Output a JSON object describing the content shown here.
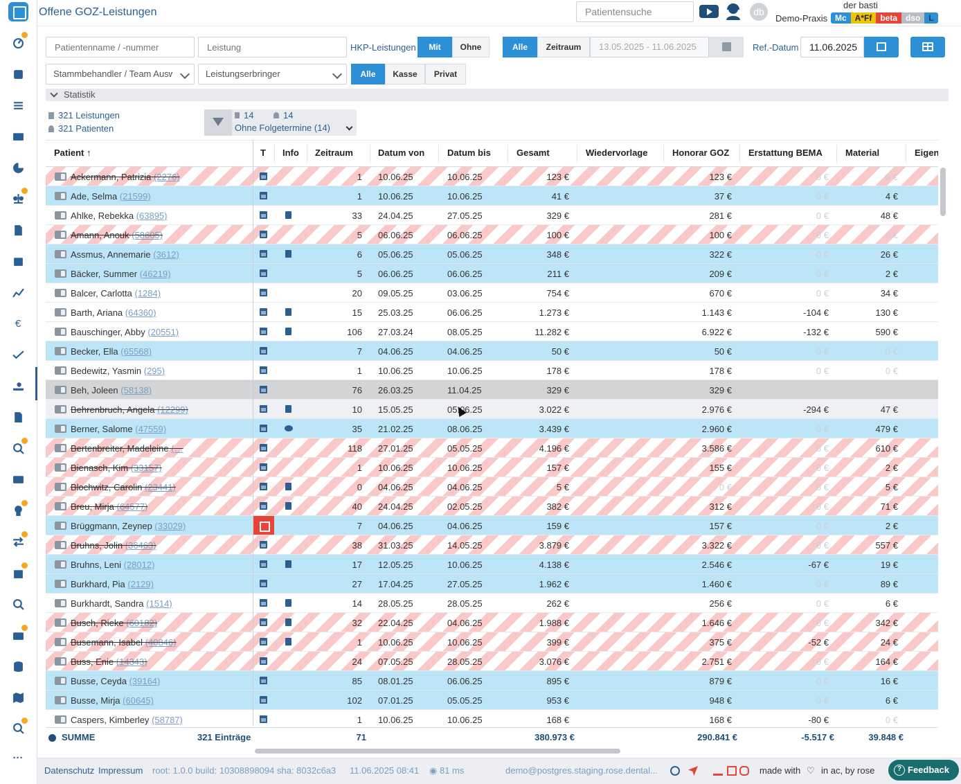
{
  "header": {
    "title": "Offene GOZ-Leistungen",
    "search_placeholder": "Patientensuche",
    "avatar_initials": "db",
    "user": "der basti",
    "practice": "Demo-Praxis",
    "badges": [
      {
        "label": "Mc",
        "color": "#2d8fd5"
      },
      {
        "label": "A*Ff",
        "color": "#f2c200"
      },
      {
        "label": "beta",
        "color": "#e5453b"
      },
      {
        "label": "dso",
        "color": "#b9bec4"
      },
      {
        "label": "L",
        "color": "#2d8fd5"
      }
    ]
  },
  "filters": {
    "patient_placeholder": "Patientenname / -nummer",
    "service_placeholder": "Leistung",
    "hkp_label": "HKP-Leistungen",
    "hkp_options": [
      "Mit",
      "Ohne"
    ],
    "period_options": [
      "Alle",
      "Zeitraum"
    ],
    "date_range": "13.05.2025 - 11.06.2025",
    "ref_label": "Ref.-Datum",
    "ref_date": "11.06.2025",
    "doctor_select": "Stammbehandler / Team Auswahl",
    "provider_select": "Leistungserbringer",
    "insurance_options": [
      "Alle",
      "Kasse",
      "Privat"
    ]
  },
  "stats": {
    "toggle_label": "Statistik",
    "services": "321 Leistungen",
    "patients": "321 Patienten",
    "filter_count_a": "14",
    "filter_count_b": "14",
    "filter_select": "Ohne Folgetermine (14)"
  },
  "table": {
    "columns": [
      "Patient ↑",
      "T",
      "Info",
      "Zeitraum",
      "Datum von",
      "Datum bis",
      "Gesamt",
      "Wiedervorlage",
      "Honorar GOZ",
      "Erstattung BEMA",
      "Material",
      "Eigenlal"
    ],
    "rows": [
      {
        "name": "Ackermann, Patrizia",
        "num": "(2276)",
        "style": "stripe",
        "strike": true,
        "doc": false,
        "chat": false,
        "cal_red": false,
        "zeitraum": "1",
        "von": "10.06.25",
        "bis": "10.06.25",
        "gesamt": "123 €",
        "honorar": "123 €",
        "bema": "0 €",
        "bema_faded": true,
        "material": "0 €",
        "material_faded": true
      },
      {
        "name": "Ade, Selma",
        "num": "(21599)",
        "style": "blue",
        "strike": false,
        "doc": false,
        "chat": false,
        "cal_red": false,
        "zeitraum": "1",
        "von": "10.06.25",
        "bis": "10.06.25",
        "gesamt": "41 €",
        "honorar": "37 €",
        "bema": "0 €",
        "bema_faded": true,
        "material": "4 €",
        "material_faded": false
      },
      {
        "name": "Ahlke, Rebekka",
        "num": "(63895)",
        "style": "white",
        "strike": false,
        "doc": true,
        "chat": false,
        "cal_red": false,
        "zeitraum": "33",
        "von": "24.04.25",
        "bis": "27.05.25",
        "gesamt": "329 €",
        "honorar": "281 €",
        "bema": "0 €",
        "bema_faded": true,
        "material": "48 €",
        "material_faded": false
      },
      {
        "name": "Amann, Anouk",
        "num": "(58605)",
        "style": "stripe",
        "strike": true,
        "doc": false,
        "chat": false,
        "cal_red": false,
        "zeitraum": "5",
        "von": "06.06.25",
        "bis": "06.06.25",
        "gesamt": "100 €",
        "honorar": "100 €",
        "bema": "0 €",
        "bema_faded": true,
        "material": "0 €",
        "material_faded": true
      },
      {
        "name": "Assmus, Annemarie",
        "num": "(3612)",
        "style": "blue",
        "strike": false,
        "doc": true,
        "chat": false,
        "cal_red": false,
        "zeitraum": "6",
        "von": "05.06.25",
        "bis": "05.06.25",
        "gesamt": "348 €",
        "honorar": "322 €",
        "bema": "0 €",
        "bema_faded": true,
        "material": "26 €",
        "material_faded": false
      },
      {
        "name": "Bäcker, Summer",
        "num": "(46219)",
        "style": "blue",
        "strike": false,
        "doc": false,
        "chat": false,
        "cal_red": false,
        "zeitraum": "5",
        "von": "06.06.25",
        "bis": "06.06.25",
        "gesamt": "211 €",
        "honorar": "209 €",
        "bema": "0 €",
        "bema_faded": true,
        "material": "2 €",
        "material_faded": false
      },
      {
        "name": "Balcer, Carlotta",
        "num": "(1284)",
        "style": "white",
        "strike": false,
        "doc": false,
        "chat": false,
        "cal_red": false,
        "zeitraum": "20",
        "von": "09.05.25",
        "bis": "03.06.25",
        "gesamt": "754 €",
        "honorar": "670 €",
        "bema": "0 €",
        "bema_faded": true,
        "material": "34 €",
        "material_faded": false
      },
      {
        "name": "Barth, Ariana",
        "num": "(64360)",
        "style": "white",
        "strike": false,
        "doc": true,
        "chat": false,
        "cal_red": false,
        "zeitraum": "15",
        "von": "25.03.25",
        "bis": "06.06.25",
        "gesamt": "1.273 €",
        "honorar": "1.143 €",
        "bema": "-104 €",
        "bema_faded": false,
        "material": "130 €",
        "material_faded": false
      },
      {
        "name": "Bauschinger, Abby",
        "num": "(20551)",
        "style": "white",
        "strike": false,
        "doc": true,
        "chat": false,
        "cal_red": false,
        "zeitraum": "106",
        "von": "27.03.24",
        "bis": "08.05.25",
        "gesamt": "11.282 €",
        "honorar": "6.922 €",
        "bema": "-132 €",
        "bema_faded": false,
        "material": "590 €",
        "material_faded": false
      },
      {
        "name": "Becker, Ella",
        "num": "(65568)",
        "style": "blue",
        "strike": false,
        "doc": false,
        "chat": false,
        "cal_red": false,
        "zeitraum": "7",
        "von": "04.06.25",
        "bis": "04.06.25",
        "gesamt": "50 €",
        "honorar": "50 €",
        "bema": "0 €",
        "bema_faded": true,
        "material": "0 €",
        "material_faded": true
      },
      {
        "name": "Bedewitz, Yasmin",
        "num": "(295)",
        "style": "white",
        "strike": false,
        "doc": false,
        "chat": false,
        "cal_red": false,
        "zeitraum": "1",
        "von": "10.06.25",
        "bis": "10.06.25",
        "gesamt": "178 €",
        "honorar": "178 €",
        "bema": "0 €",
        "bema_faded": true,
        "material": "0 €",
        "material_faded": true
      },
      {
        "name": "Beh, Joleen",
        "num": "(58138)",
        "style": "gray",
        "strike": false,
        "doc": false,
        "chat": false,
        "cal_red": false,
        "zeitraum": "76",
        "von": "26.03.25",
        "bis": "11.04.25",
        "gesamt": "329 €",
        "honorar": "329 €",
        "bema": "",
        "bema_faded": false,
        "material": "",
        "material_faded": false
      },
      {
        "name": "Behrenbruch, Angela",
        "num": "(12299)",
        "style": "hover",
        "strike": true,
        "doc": true,
        "chat": false,
        "cal_red": false,
        "zeitraum": "10",
        "von": "15.05.25",
        "bis": "05.06.25",
        "gesamt": "3.022 €",
        "honorar": "2.976 €",
        "bema": "-294 €",
        "bema_faded": false,
        "material": "47 €",
        "material_faded": false
      },
      {
        "name": "Berner, Salome",
        "num": "(47559)",
        "style": "blue",
        "strike": false,
        "doc": false,
        "chat": true,
        "cal_red": false,
        "zeitraum": "35",
        "von": "21.02.25",
        "bis": "08.06.25",
        "gesamt": "3.439 €",
        "honorar": "2.960 €",
        "bema": "0 €",
        "bema_faded": true,
        "material": "479 €",
        "material_faded": false
      },
      {
        "name": "Bertenbreiter, Madeleine",
        "num": "(…",
        "style": "stripe",
        "strike": true,
        "doc": false,
        "chat": false,
        "cal_red": false,
        "zeitraum": "118",
        "von": "27.01.25",
        "bis": "05.05.25",
        "gesamt": "4.196 €",
        "honorar": "3.586 €",
        "bema": "0 €",
        "bema_faded": true,
        "material": "610 €",
        "material_faded": false
      },
      {
        "name": "Bienasch, Kim",
        "num": "(33157)",
        "style": "stripe",
        "strike": true,
        "doc": false,
        "chat": false,
        "cal_red": false,
        "zeitraum": "1",
        "von": "10.06.25",
        "bis": "10.06.25",
        "gesamt": "157 €",
        "honorar": "155 €",
        "bema": "0 €",
        "bema_faded": true,
        "material": "2 €",
        "material_faded": false
      },
      {
        "name": "Blochwitz, Carolin",
        "num": "(23441)",
        "style": "stripe",
        "strike": true,
        "doc": true,
        "chat": false,
        "cal_red": false,
        "zeitraum": "0",
        "von": "04.06.25",
        "bis": "04.06.25",
        "gesamt": "5 €",
        "honorar": "0 €",
        "honorar_faded": true,
        "bema": "0 €",
        "bema_faded": true,
        "material": "5 €",
        "material_faded": false
      },
      {
        "name": "Breu, Mirja",
        "num": "(64577)",
        "style": "stripe",
        "strike": true,
        "doc": true,
        "chat": false,
        "cal_red": false,
        "zeitraum": "40",
        "von": "24.04.25",
        "bis": "02.05.25",
        "gesamt": "382 €",
        "honorar": "312 €",
        "bema": "0 €",
        "bema_faded": true,
        "material": "71 €",
        "material_faded": false
      },
      {
        "name": "Brüggmann, Zeynep",
        "num": "(33029)",
        "style": "blue",
        "strike": false,
        "doc": false,
        "chat": false,
        "cal_red": true,
        "zeitraum": "7",
        "von": "04.06.25",
        "bis": "04.06.25",
        "gesamt": "159 €",
        "honorar": "157 €",
        "bema": "0 €",
        "bema_faded": true,
        "material": "2 €",
        "material_faded": false
      },
      {
        "name": "Bruhns, Jolin",
        "num": "(36463)",
        "style": "stripe",
        "strike": true,
        "doc": false,
        "chat": false,
        "cal_red": false,
        "zeitraum": "38",
        "von": "31.03.25",
        "bis": "14.05.25",
        "gesamt": "3.879 €",
        "honorar": "3.322 €",
        "bema": "0 €",
        "bema_faded": true,
        "material": "557 €",
        "material_faded": false
      },
      {
        "name": "Bruhns, Leni",
        "num": "(28012)",
        "style": "blue",
        "strike": false,
        "doc": true,
        "chat": false,
        "cal_red": false,
        "zeitraum": "17",
        "von": "12.05.25",
        "bis": "10.06.25",
        "gesamt": "4.138 €",
        "honorar": "2.546 €",
        "bema": "-67 €",
        "bema_faded": false,
        "material": "19 €",
        "material_faded": false
      },
      {
        "name": "Burkhard, Pia",
        "num": "(2129)",
        "style": "blue",
        "strike": false,
        "doc": false,
        "chat": false,
        "cal_red": false,
        "zeitraum": "27",
        "von": "17.04.25",
        "bis": "27.05.25",
        "gesamt": "1.962 €",
        "honorar": "1.460 €",
        "bema": "0 €",
        "bema_faded": true,
        "material": "89 €",
        "material_faded": false
      },
      {
        "name": "Burkhardt, Sandra",
        "num": "(1514)",
        "style": "white",
        "strike": false,
        "doc": true,
        "chat": false,
        "cal_red": false,
        "zeitraum": "14",
        "von": "28.05.25",
        "bis": "28.05.25",
        "gesamt": "262 €",
        "honorar": "256 €",
        "bema": "0 €",
        "bema_faded": true,
        "material": "6 €",
        "material_faded": false
      },
      {
        "name": "Busch, Rieke",
        "num": "(60182)",
        "style": "stripe",
        "strike": true,
        "doc": true,
        "chat": false,
        "cal_red": false,
        "zeitraum": "32",
        "von": "22.04.25",
        "bis": "04.06.25",
        "gesamt": "1.988 €",
        "honorar": "1.646 €",
        "bema": "0 €",
        "bema_faded": true,
        "material": "342 €",
        "material_faded": false
      },
      {
        "name": "Busemann, Isabel",
        "num": "(40846)",
        "style": "stripe",
        "strike": true,
        "doc": true,
        "chat": false,
        "cal_red": false,
        "zeitraum": "1",
        "von": "10.06.25",
        "bis": "10.06.25",
        "gesamt": "399 €",
        "honorar": "375 €",
        "bema": "-52 €",
        "bema_faded": false,
        "material": "24 €",
        "material_faded": false
      },
      {
        "name": "Buss, Enie",
        "num": "(14343)",
        "style": "stripe",
        "strike": true,
        "doc": false,
        "chat": false,
        "cal_red": false,
        "zeitraum": "24",
        "von": "07.05.25",
        "bis": "28.05.25",
        "gesamt": "3.076 €",
        "honorar": "2.751 €",
        "bema": "0 €",
        "bema_faded": true,
        "material": "164 €",
        "material_faded": false
      },
      {
        "name": "Busse, Ceyda",
        "num": "(39164)",
        "style": "blue",
        "strike": false,
        "doc": false,
        "chat": false,
        "cal_red": false,
        "zeitraum": "85",
        "von": "08.01.25",
        "bis": "06.06.25",
        "gesamt": "895 €",
        "honorar": "879 €",
        "bema": "0 €",
        "bema_faded": true,
        "material": "16 €",
        "material_faded": false
      },
      {
        "name": "Busse, Mirja",
        "num": "(60645)",
        "style": "blue",
        "strike": false,
        "doc": false,
        "chat": false,
        "cal_red": false,
        "zeitraum": "102",
        "von": "07.01.25",
        "bis": "05.05.25",
        "gesamt": "953 €",
        "honorar": "948 €",
        "bema": "0 €",
        "bema_faded": true,
        "material": "6 €",
        "material_faded": false
      },
      {
        "name": "Caspers, Kimberley",
        "num": "(58787)",
        "style": "white",
        "strike": false,
        "doc": false,
        "chat": false,
        "cal_red": false,
        "zeitraum": "1",
        "von": "10.06.25",
        "bis": "10.06.25",
        "gesamt": "168 €",
        "honorar": "168 €",
        "bema": "-80 €",
        "bema_faded": false,
        "material": "0 €",
        "material_faded": true
      }
    ],
    "sum": {
      "label": "SUMME",
      "entries": "321 Einträge",
      "zeitraum": "71",
      "gesamt": "380.973 €",
      "honorar": "290.841 €",
      "bema": "-5.517 €",
      "material": "39.848 €"
    }
  },
  "footer": {
    "privacy": "Datenschutz",
    "imprint": "Impressum",
    "build": "root: 1.0.0 build: 10308898094 sha: 8032c6a3",
    "datetime": "11.06.2025 08:41",
    "timing": "81 ms",
    "db": "demo@postgres.staging.rose.dental...",
    "made_with": "made with",
    "in_ac": "in ac, by rose",
    "feedback": "Feedback"
  }
}
